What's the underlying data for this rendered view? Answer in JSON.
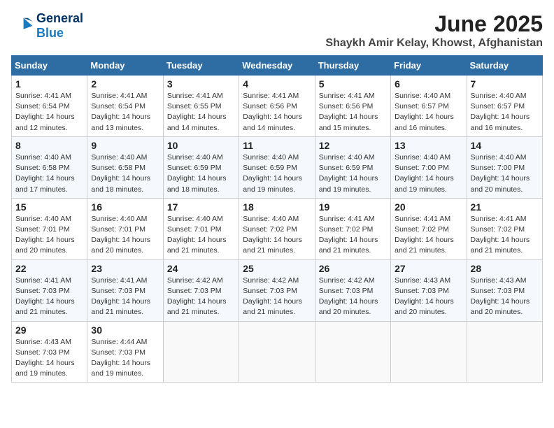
{
  "logo": {
    "line1": "General",
    "line2": "Blue"
  },
  "title": "June 2025",
  "subtitle": "Shaykh Amir Kelay, Khowst, Afghanistan",
  "weekdays": [
    "Sunday",
    "Monday",
    "Tuesday",
    "Wednesday",
    "Thursday",
    "Friday",
    "Saturday"
  ],
  "weeks": [
    [
      {
        "day": "1",
        "info": "Sunrise: 4:41 AM\nSunset: 6:54 PM\nDaylight: 14 hours\nand 12 minutes."
      },
      {
        "day": "2",
        "info": "Sunrise: 4:41 AM\nSunset: 6:54 PM\nDaylight: 14 hours\nand 13 minutes."
      },
      {
        "day": "3",
        "info": "Sunrise: 4:41 AM\nSunset: 6:55 PM\nDaylight: 14 hours\nand 14 minutes."
      },
      {
        "day": "4",
        "info": "Sunrise: 4:41 AM\nSunset: 6:56 PM\nDaylight: 14 hours\nand 14 minutes."
      },
      {
        "day": "5",
        "info": "Sunrise: 4:41 AM\nSunset: 6:56 PM\nDaylight: 14 hours\nand 15 minutes."
      },
      {
        "day": "6",
        "info": "Sunrise: 4:40 AM\nSunset: 6:57 PM\nDaylight: 14 hours\nand 16 minutes."
      },
      {
        "day": "7",
        "info": "Sunrise: 4:40 AM\nSunset: 6:57 PM\nDaylight: 14 hours\nand 16 minutes."
      }
    ],
    [
      {
        "day": "8",
        "info": "Sunrise: 4:40 AM\nSunset: 6:58 PM\nDaylight: 14 hours\nand 17 minutes."
      },
      {
        "day": "9",
        "info": "Sunrise: 4:40 AM\nSunset: 6:58 PM\nDaylight: 14 hours\nand 18 minutes."
      },
      {
        "day": "10",
        "info": "Sunrise: 4:40 AM\nSunset: 6:59 PM\nDaylight: 14 hours\nand 18 minutes."
      },
      {
        "day": "11",
        "info": "Sunrise: 4:40 AM\nSunset: 6:59 PM\nDaylight: 14 hours\nand 19 minutes."
      },
      {
        "day": "12",
        "info": "Sunrise: 4:40 AM\nSunset: 6:59 PM\nDaylight: 14 hours\nand 19 minutes."
      },
      {
        "day": "13",
        "info": "Sunrise: 4:40 AM\nSunset: 7:00 PM\nDaylight: 14 hours\nand 19 minutes."
      },
      {
        "day": "14",
        "info": "Sunrise: 4:40 AM\nSunset: 7:00 PM\nDaylight: 14 hours\nand 20 minutes."
      }
    ],
    [
      {
        "day": "15",
        "info": "Sunrise: 4:40 AM\nSunset: 7:01 PM\nDaylight: 14 hours\nand 20 minutes."
      },
      {
        "day": "16",
        "info": "Sunrise: 4:40 AM\nSunset: 7:01 PM\nDaylight: 14 hours\nand 20 minutes."
      },
      {
        "day": "17",
        "info": "Sunrise: 4:40 AM\nSunset: 7:01 PM\nDaylight: 14 hours\nand 21 minutes."
      },
      {
        "day": "18",
        "info": "Sunrise: 4:40 AM\nSunset: 7:02 PM\nDaylight: 14 hours\nand 21 minutes."
      },
      {
        "day": "19",
        "info": "Sunrise: 4:41 AM\nSunset: 7:02 PM\nDaylight: 14 hours\nand 21 minutes."
      },
      {
        "day": "20",
        "info": "Sunrise: 4:41 AM\nSunset: 7:02 PM\nDaylight: 14 hours\nand 21 minutes."
      },
      {
        "day": "21",
        "info": "Sunrise: 4:41 AM\nSunset: 7:02 PM\nDaylight: 14 hours\nand 21 minutes."
      }
    ],
    [
      {
        "day": "22",
        "info": "Sunrise: 4:41 AM\nSunset: 7:03 PM\nDaylight: 14 hours\nand 21 minutes."
      },
      {
        "day": "23",
        "info": "Sunrise: 4:41 AM\nSunset: 7:03 PM\nDaylight: 14 hours\nand 21 minutes."
      },
      {
        "day": "24",
        "info": "Sunrise: 4:42 AM\nSunset: 7:03 PM\nDaylight: 14 hours\nand 21 minutes."
      },
      {
        "day": "25",
        "info": "Sunrise: 4:42 AM\nSunset: 7:03 PM\nDaylight: 14 hours\nand 21 minutes."
      },
      {
        "day": "26",
        "info": "Sunrise: 4:42 AM\nSunset: 7:03 PM\nDaylight: 14 hours\nand 20 minutes."
      },
      {
        "day": "27",
        "info": "Sunrise: 4:43 AM\nSunset: 7:03 PM\nDaylight: 14 hours\nand 20 minutes."
      },
      {
        "day": "28",
        "info": "Sunrise: 4:43 AM\nSunset: 7:03 PM\nDaylight: 14 hours\nand 20 minutes."
      }
    ],
    [
      {
        "day": "29",
        "info": "Sunrise: 4:43 AM\nSunset: 7:03 PM\nDaylight: 14 hours\nand 19 minutes."
      },
      {
        "day": "30",
        "info": "Sunrise: 4:44 AM\nSunset: 7:03 PM\nDaylight: 14 hours\nand 19 minutes."
      },
      null,
      null,
      null,
      null,
      null
    ]
  ]
}
